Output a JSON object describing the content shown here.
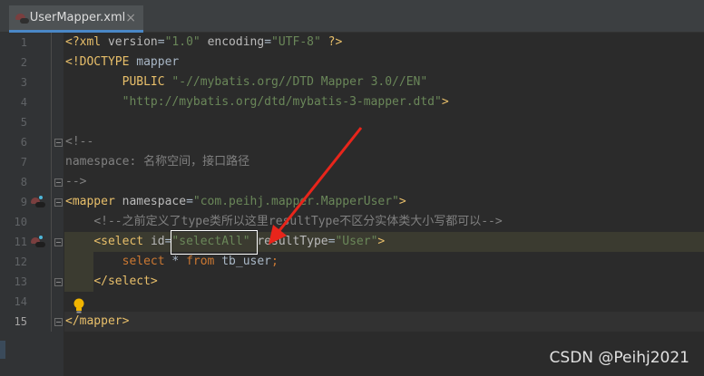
{
  "tab": {
    "filename": "UserMapper.xml",
    "close": "×"
  },
  "lines": [
    {
      "n": "1",
      "parts": [
        [
          "t-tag",
          "<?xml "
        ],
        [
          "t-attr",
          "version"
        ],
        [
          "t-plain",
          "="
        ],
        [
          "t-str",
          "\"1.0\""
        ],
        [
          "t-plain",
          " "
        ],
        [
          "t-attr",
          "encoding"
        ],
        [
          "t-plain",
          "="
        ],
        [
          "t-str",
          "\"UTF-8\""
        ],
        [
          "t-plain",
          " "
        ],
        [
          "t-tag",
          "?>"
        ]
      ]
    },
    {
      "n": "2",
      "parts": [
        [
          "t-tag",
          "<!DOCTYPE "
        ],
        [
          "t-plain",
          "mapper"
        ]
      ]
    },
    {
      "n": "3",
      "parts": [
        [
          "t-plain",
          "        "
        ],
        [
          "t-tag",
          "PUBLIC "
        ],
        [
          "t-str",
          "\"-//mybatis.org//DTD Mapper 3.0//EN\""
        ]
      ]
    },
    {
      "n": "4",
      "parts": [
        [
          "t-plain",
          "        "
        ],
        [
          "t-str",
          "\"http://mybatis.org/dtd/mybatis-3-mapper.dtd\""
        ],
        [
          "t-tag",
          ">"
        ]
      ]
    },
    {
      "n": "5",
      "parts": []
    },
    {
      "n": "6",
      "parts": [
        [
          "t-com",
          "<!--"
        ]
      ]
    },
    {
      "n": "7",
      "parts": [
        [
          "t-com",
          "namespace: 名称空间，接口路径"
        ]
      ]
    },
    {
      "n": "8",
      "parts": [
        [
          "t-com",
          "-->"
        ]
      ]
    },
    {
      "n": "9",
      "parts": [
        [
          "t-tag",
          "<mapper "
        ],
        [
          "t-attr",
          "namespace"
        ],
        [
          "t-plain",
          "="
        ],
        [
          "t-str",
          "\"com.peihj.mapper.MapperUser\""
        ],
        [
          "t-tag",
          ">"
        ]
      ]
    },
    {
      "n": "10",
      "parts": [
        [
          "t-plain",
          "    "
        ],
        [
          "t-com",
          "<!--之前定义了type类所以这里resultType不区分实体类大小写都可以-->"
        ]
      ]
    },
    {
      "n": "11",
      "parts": [
        [
          "t-plain",
          "    "
        ],
        [
          "t-tag",
          "<select "
        ],
        [
          "t-attr",
          "id"
        ],
        [
          "t-plain",
          "="
        ],
        [
          "t-str",
          "\"selectAll\""
        ],
        [
          "t-plain",
          " "
        ],
        [
          "t-attr",
          "resultType"
        ],
        [
          "t-plain",
          "="
        ],
        [
          "t-str",
          "\"User\""
        ],
        [
          "t-tag",
          ">"
        ]
      ]
    },
    {
      "n": "12",
      "parts": [
        [
          "t-plain",
          "        "
        ],
        [
          "t-kw",
          "select "
        ],
        [
          "t-plain",
          "* "
        ],
        [
          "t-kw",
          "from "
        ],
        [
          "t-plain",
          "tb_user"
        ],
        [
          "t-kw",
          ";"
        ]
      ]
    },
    {
      "n": "13",
      "parts": [
        [
          "t-plain",
          "    "
        ],
        [
          "t-tag",
          "</select>"
        ]
      ]
    },
    {
      "n": "14",
      "parts": []
    },
    {
      "n": "15",
      "parts": [
        [
          "t-tag",
          "</mapper>"
        ]
      ]
    }
  ],
  "watermark": "CSDN @Peihj2021",
  "colors": {
    "tag": "#e8bf6a",
    "string": "#6a8759",
    "keyword": "#cc7832",
    "comment": "#808080",
    "annotation_box": "#ffffff",
    "arrow": "#e8251b"
  },
  "icons": {
    "tab": "mybatis-bird-icon",
    "gutter": "mapper-navigation-icon",
    "bulb": "lightbulb-icon"
  }
}
